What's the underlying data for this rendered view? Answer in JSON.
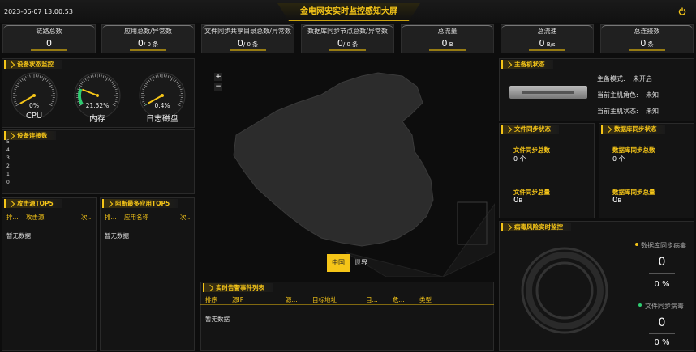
{
  "header": {
    "timestamp": "2023-06-07 13:00:53",
    "title": "金电网安实时监控感知大屏",
    "power_icon": "power-icon"
  },
  "stats": [
    {
      "label": "链路总数",
      "value": "0",
      "unit": ""
    },
    {
      "label": "应用总数/异常数",
      "value": "0",
      "unit": "/ 0 条"
    },
    {
      "label": "文件同步共享目录总数/异常数",
      "value": "0",
      "unit": "/ 0 条"
    },
    {
      "label": "数据库同步节点总数/异常数",
      "value": "0",
      "unit": "/ 0 条"
    },
    {
      "label": "总流量",
      "value": "0",
      "unit": " B"
    },
    {
      "label": "总流速",
      "value": "0",
      "unit": " B/s"
    },
    {
      "label": "总连接数",
      "value": "0",
      "unit": " 条"
    }
  ],
  "device": {
    "title": "设备状态监控",
    "gauges": [
      {
        "label": "CPU",
        "value": "0%",
        "pct": 0
      },
      {
        "label": "内存",
        "value": "21.52%",
        "pct": 21.52
      },
      {
        "label": "日志磁盘",
        "value": "0.4%",
        "pct": 0.4
      }
    ]
  },
  "conn": {
    "title": "设备连接数",
    "axis": [
      "5",
      "4",
      "3",
      "2",
      "1",
      "0"
    ]
  },
  "attack": {
    "title": "攻击源TOP5",
    "cols": [
      "排...",
      "攻击源",
      "次..."
    ],
    "empty": "暂无数据"
  },
  "blocked": {
    "title": "阻断最多应用TOP5",
    "cols": [
      "排...",
      "应用名称",
      "次..."
    ],
    "empty": "暂无数据"
  },
  "map": {
    "zoom_in": "+",
    "zoom_out": "−",
    "tabs": [
      "中国",
      "世界"
    ],
    "active_tab": "中国"
  },
  "alarms": {
    "title": "实时告警事件列表",
    "cols": [
      "排序",
      "源IP",
      "源...",
      "目标地址",
      "目...",
      "危...",
      "类型"
    ],
    "empty": "暂无数据"
  },
  "host": {
    "title": "主备机状态",
    "mode_label": "主备模式:",
    "mode_value": "未开启",
    "role_label": "当前主机角色:",
    "role_value": "未知",
    "state_label": "当前主机状态:",
    "state_value": "未知"
  },
  "filesync": {
    "title": "文件同步状态",
    "total_label": "文件同步总数",
    "total_value": "0 个",
    "size_label": "文件同步总量",
    "size_value": "0",
    "size_unit": "B"
  },
  "dbsync": {
    "title": "数据库同步状态",
    "total_label": "数据库同步总数",
    "total_value": "0 个",
    "size_label": "数据库同步总量",
    "size_value": "0",
    "size_unit": "B"
  },
  "virus": {
    "title": "病毒风险实时监控",
    "db_label": "数据库同步病毒",
    "db_count": "0",
    "db_pct": "0 %",
    "file_label": "文件同步病毒",
    "file_count": "0",
    "file_pct": "0 %",
    "db_color": "#f5c518",
    "file_color": "#2ecc71"
  }
}
